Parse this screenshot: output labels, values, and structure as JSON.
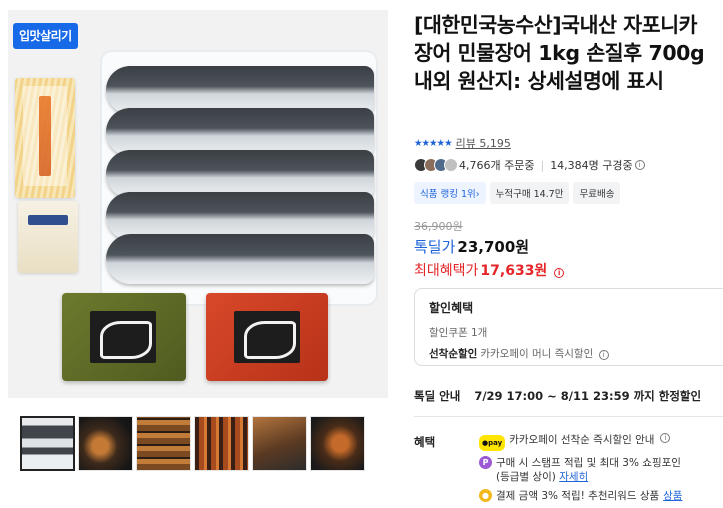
{
  "image": {
    "badge": "입맛살리기"
  },
  "product": {
    "title": "[대한민국농수산]국내산 자포니카 장어 민물장어 1kg 손질후 700g내외 원산지: 상세설명에 표시",
    "stars": "★★★★★",
    "reviews_label": "리뷰 5,195",
    "orders": "4,766개 주문중",
    "subscribers": "14,384명 구경중",
    "tags": [
      "식품 랭킹 1위›",
      "누적구매 14.7만",
      "무료배송"
    ],
    "original_price": "36,900원",
    "deal_label": "톡딜가",
    "deal_price": "23,700원",
    "max_label": "최대혜택가",
    "max_price": "17,633원"
  },
  "benefit_box": {
    "title": "할인혜택",
    "line1": "할인쿠폰 1개",
    "line2_bold": "선착순할인",
    "line2": "카카오페이 머니 즉시할인"
  },
  "deal_info": {
    "label": "톡딜 안내",
    "period": "7/29 17:00 ~ 8/11 23:59 까지 한정할인"
  },
  "benefits": {
    "label": "혜택",
    "pay_badge": "●pay",
    "item1": "카카오페이 선착순 즉시할인 안내",
    "p_badge": "P",
    "item2a": "구매 시 스탬프 적립 및 최대 3% 쇼핑포인",
    "item2b": "(등급별 상이)",
    "item2_link": "자세히",
    "item3": "결제 금액 3% 적립! 추천리워드 상품",
    "item3_link": "상품"
  },
  "icons": [
    "info-icon",
    "kakaopay-icon",
    "point-icon",
    "coin-icon"
  ]
}
